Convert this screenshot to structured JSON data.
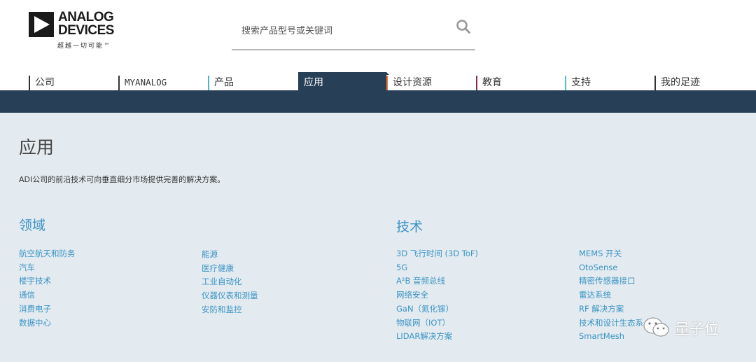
{
  "header": {
    "logo_line1": "ANALOG",
    "logo_line2": "DEVICES",
    "tagline": "超越一切可能™",
    "search_placeholder": "搜索产品型号或关键词"
  },
  "nav": {
    "items": [
      {
        "label": "公司",
        "bar_color": "#333333"
      },
      {
        "label": "MYANALOG",
        "bar_color": "#333333"
      },
      {
        "label": "产品",
        "bar_color": "#4fb3c9"
      },
      {
        "label": "应用",
        "bar_color": "#273f57"
      },
      {
        "label": "设计资源",
        "bar_color": "#e8733a"
      },
      {
        "label": "教育",
        "bar_color": "#8a2b4f"
      },
      {
        "label": "支持",
        "bar_color": "#4fc3c9"
      },
      {
        "label": "我的足迹",
        "bar_color": "#333333"
      }
    ],
    "active": "应用"
  },
  "main": {
    "title": "应用",
    "description": "ADI公司的前沿技术可向垂直细分市场提供完善的解决方案。",
    "sections": [
      {
        "title": "领域",
        "columns": [
          [
            "航空航天和防务",
            "汽车",
            "楼宇技术",
            "通信",
            "消费电子",
            "数据中心"
          ],
          [
            "能源",
            "医疗健康",
            "工业自动化",
            "仪器仪表和测量",
            "安防和监控"
          ]
        ]
      },
      {
        "title": "技术",
        "columns": [
          [
            "3D 飞行时间 (3D ToF)",
            "5G",
            "A²B 音频总线",
            "网络安全",
            "GaN（氮化镓）",
            "物联网（IOT）",
            "LIDAR解决方案"
          ],
          [
            "MEMS 开关",
            "OtoSense",
            "精密传感器接口",
            "雷达系统",
            "RF 解决方案",
            "技术和设计生态系",
            "SmartMesh"
          ]
        ]
      }
    ]
  },
  "watermark": {
    "text": "量子位"
  },
  "colors": {
    "nav_band": "#273f57",
    "content_bg": "#e4ebf0",
    "link": "#3a93c4"
  }
}
